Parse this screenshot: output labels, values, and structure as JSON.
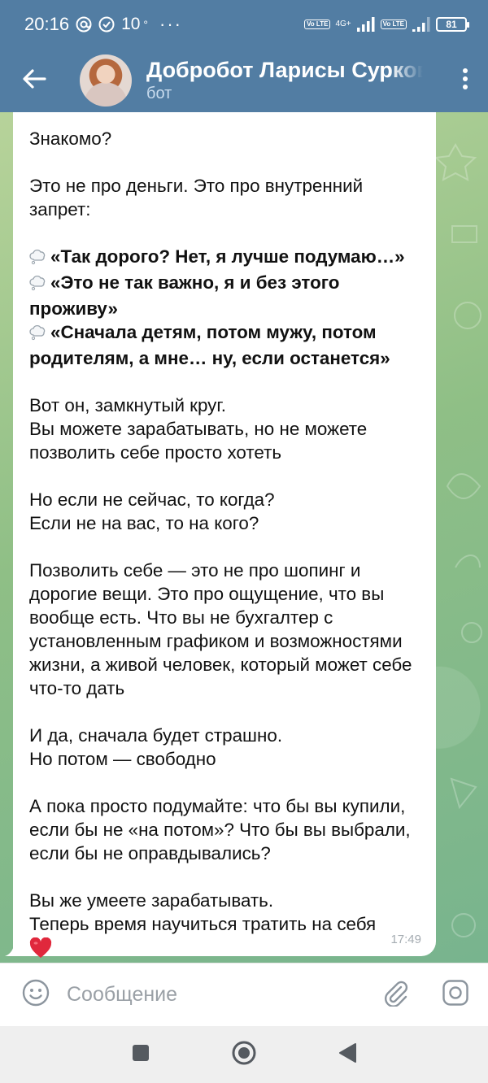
{
  "status_bar": {
    "time": "20:16",
    "at_icon": "at-icon",
    "temperature": "10",
    "degree": "°",
    "more": "···",
    "network_label": "4G+",
    "battery": "81",
    "volte_label_1": "Vo LTE",
    "volte_label_2": "Vo LTE"
  },
  "header": {
    "title": "Добробот Ларисы Сурковой",
    "subtitle": "бот",
    "back_icon": "arrow-left-icon",
    "menu_icon": "more-vertical-icon"
  },
  "message": {
    "p1": "Знакомо?",
    "p2": "Это не про деньги. Это про внутренний запрет:",
    "quote1": "«Так дорого? Нет, я лучше подумаю…»",
    "quote2": "«Это не так важно, я и без этого проживу»",
    "quote3": "«Сначала детям, потом мужу, потом родителям, а мне… ну, если останется»",
    "p3_line1": "Вот он, замкнутый круг.",
    "p3_line2": "Вы можете зарабатывать, но не можете позволить себе просто хотеть",
    "p4_line1": "Но если не сейчас, то когда?",
    "p4_line2": "Если не на вас, то на кого?",
    "p5": "Позволить себе — это не про шопинг и дорогие вещи. Это про ощущение, что вы вообще есть. Что вы не бухгалтер с установленным графиком и возможностями жизни, а живой человек, который может себе что-то дать",
    "p6_line1": "И да, сначала будет страшно.",
    "p6_line2": "Но потом — свободно",
    "p7": "А пока просто подумайте: что бы вы купили, если бы не «на потом»? Что бы вы выбрали, если бы не оправдывались?",
    "p8_line1": "Вы же умеете зарабатывать.",
    "p8_line2": "Теперь время научиться тратить на себя",
    "time": "17:49",
    "bullet_icon": "thought-balloon-icon",
    "end_icon": "red-heart-icon"
  },
  "input": {
    "placeholder": "Сообщение",
    "emoji_icon": "smiley-icon",
    "attach_icon": "paperclip-icon",
    "camera_icon": "instagram-camera-icon"
  },
  "nav": {
    "recents_icon": "square-icon",
    "home_icon": "circle-icon",
    "back_icon": "triangle-back-icon"
  },
  "colors": {
    "header": "#527da3",
    "bubble": "#ffffff",
    "timestamp": "#a5acb2",
    "heart": "#e0283c"
  }
}
